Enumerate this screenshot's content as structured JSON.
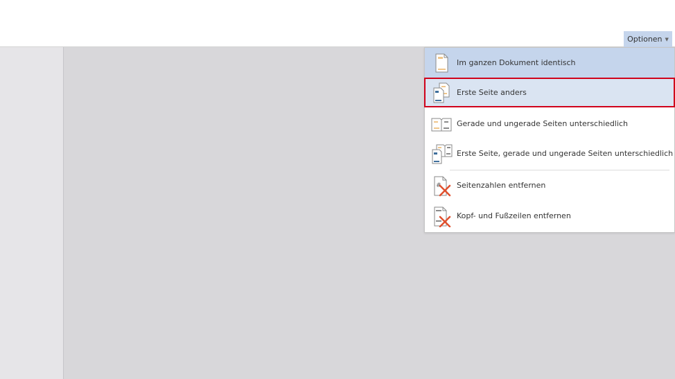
{
  "ribbon": {
    "options_label": "Optionen"
  },
  "menu": {
    "items": [
      {
        "label": "Im ganzen Dokument identisch",
        "icon": "single-page-header-icon",
        "state": "selected"
      },
      {
        "label": "Erste Seite anders",
        "icon": "first-page-different-icon",
        "state": "highlighted"
      },
      {
        "label": "Gerade und ungerade Seiten unterschiedlich",
        "icon": "even-odd-pages-icon",
        "state": "normal"
      },
      {
        "label": "Erste Seite, gerade und ungerade Seiten unterschiedlich",
        "icon": "first-even-odd-pages-icon",
        "state": "normal"
      },
      {
        "label": "Seitenzahlen entfernen",
        "icon": "remove-page-numbers-icon",
        "state": "normal"
      },
      {
        "label": "Kopf- und Fußzeilen entfernen",
        "icon": "remove-header-footer-icon",
        "state": "normal"
      }
    ]
  },
  "colors": {
    "selected_bg": "#c5d5ec",
    "highlight_border": "#d0021b",
    "canvas_bg": "#d8d7da",
    "icon_orange": "#f0c68b",
    "icon_blue": "#3f6f9c",
    "delete_red": "#e0502e"
  }
}
